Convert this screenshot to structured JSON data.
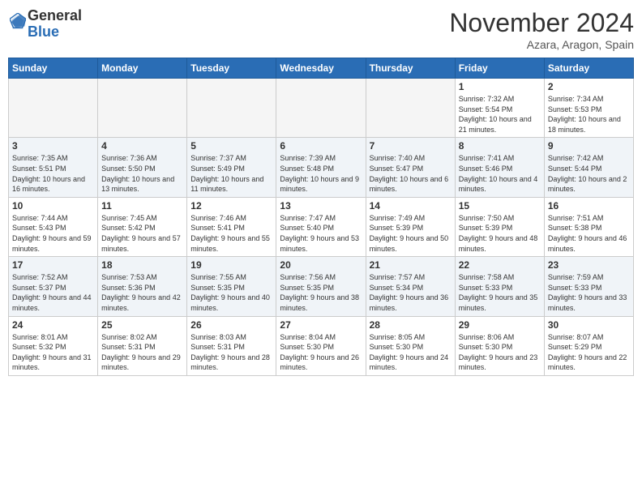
{
  "header": {
    "logo_line1": "General",
    "logo_line2": "Blue",
    "month": "November 2024",
    "location": "Azara, Aragon, Spain"
  },
  "days_of_week": [
    "Sunday",
    "Monday",
    "Tuesday",
    "Wednesday",
    "Thursday",
    "Friday",
    "Saturday"
  ],
  "weeks": [
    [
      {
        "day": "",
        "info": ""
      },
      {
        "day": "",
        "info": ""
      },
      {
        "day": "",
        "info": ""
      },
      {
        "day": "",
        "info": ""
      },
      {
        "day": "",
        "info": ""
      },
      {
        "day": "1",
        "info": "Sunrise: 7:32 AM\nSunset: 5:54 PM\nDaylight: 10 hours and 21 minutes."
      },
      {
        "day": "2",
        "info": "Sunrise: 7:34 AM\nSunset: 5:53 PM\nDaylight: 10 hours and 18 minutes."
      }
    ],
    [
      {
        "day": "3",
        "info": "Sunrise: 7:35 AM\nSunset: 5:51 PM\nDaylight: 10 hours and 16 minutes."
      },
      {
        "day": "4",
        "info": "Sunrise: 7:36 AM\nSunset: 5:50 PM\nDaylight: 10 hours and 13 minutes."
      },
      {
        "day": "5",
        "info": "Sunrise: 7:37 AM\nSunset: 5:49 PM\nDaylight: 10 hours and 11 minutes."
      },
      {
        "day": "6",
        "info": "Sunrise: 7:39 AM\nSunset: 5:48 PM\nDaylight: 10 hours and 9 minutes."
      },
      {
        "day": "7",
        "info": "Sunrise: 7:40 AM\nSunset: 5:47 PM\nDaylight: 10 hours and 6 minutes."
      },
      {
        "day": "8",
        "info": "Sunrise: 7:41 AM\nSunset: 5:46 PM\nDaylight: 10 hours and 4 minutes."
      },
      {
        "day": "9",
        "info": "Sunrise: 7:42 AM\nSunset: 5:44 PM\nDaylight: 10 hours and 2 minutes."
      }
    ],
    [
      {
        "day": "10",
        "info": "Sunrise: 7:44 AM\nSunset: 5:43 PM\nDaylight: 9 hours and 59 minutes."
      },
      {
        "day": "11",
        "info": "Sunrise: 7:45 AM\nSunset: 5:42 PM\nDaylight: 9 hours and 57 minutes."
      },
      {
        "day": "12",
        "info": "Sunrise: 7:46 AM\nSunset: 5:41 PM\nDaylight: 9 hours and 55 minutes."
      },
      {
        "day": "13",
        "info": "Sunrise: 7:47 AM\nSunset: 5:40 PM\nDaylight: 9 hours and 53 minutes."
      },
      {
        "day": "14",
        "info": "Sunrise: 7:49 AM\nSunset: 5:39 PM\nDaylight: 9 hours and 50 minutes."
      },
      {
        "day": "15",
        "info": "Sunrise: 7:50 AM\nSunset: 5:39 PM\nDaylight: 9 hours and 48 minutes."
      },
      {
        "day": "16",
        "info": "Sunrise: 7:51 AM\nSunset: 5:38 PM\nDaylight: 9 hours and 46 minutes."
      }
    ],
    [
      {
        "day": "17",
        "info": "Sunrise: 7:52 AM\nSunset: 5:37 PM\nDaylight: 9 hours and 44 minutes."
      },
      {
        "day": "18",
        "info": "Sunrise: 7:53 AM\nSunset: 5:36 PM\nDaylight: 9 hours and 42 minutes."
      },
      {
        "day": "19",
        "info": "Sunrise: 7:55 AM\nSunset: 5:35 PM\nDaylight: 9 hours and 40 minutes."
      },
      {
        "day": "20",
        "info": "Sunrise: 7:56 AM\nSunset: 5:35 PM\nDaylight: 9 hours and 38 minutes."
      },
      {
        "day": "21",
        "info": "Sunrise: 7:57 AM\nSunset: 5:34 PM\nDaylight: 9 hours and 36 minutes."
      },
      {
        "day": "22",
        "info": "Sunrise: 7:58 AM\nSunset: 5:33 PM\nDaylight: 9 hours and 35 minutes."
      },
      {
        "day": "23",
        "info": "Sunrise: 7:59 AM\nSunset: 5:33 PM\nDaylight: 9 hours and 33 minutes."
      }
    ],
    [
      {
        "day": "24",
        "info": "Sunrise: 8:01 AM\nSunset: 5:32 PM\nDaylight: 9 hours and 31 minutes."
      },
      {
        "day": "25",
        "info": "Sunrise: 8:02 AM\nSunset: 5:31 PM\nDaylight: 9 hours and 29 minutes."
      },
      {
        "day": "26",
        "info": "Sunrise: 8:03 AM\nSunset: 5:31 PM\nDaylight: 9 hours and 28 minutes."
      },
      {
        "day": "27",
        "info": "Sunrise: 8:04 AM\nSunset: 5:30 PM\nDaylight: 9 hours and 26 minutes."
      },
      {
        "day": "28",
        "info": "Sunrise: 8:05 AM\nSunset: 5:30 PM\nDaylight: 9 hours and 24 minutes."
      },
      {
        "day": "29",
        "info": "Sunrise: 8:06 AM\nSunset: 5:30 PM\nDaylight: 9 hours and 23 minutes."
      },
      {
        "day": "30",
        "info": "Sunrise: 8:07 AM\nSunset: 5:29 PM\nDaylight: 9 hours and 22 minutes."
      }
    ]
  ]
}
